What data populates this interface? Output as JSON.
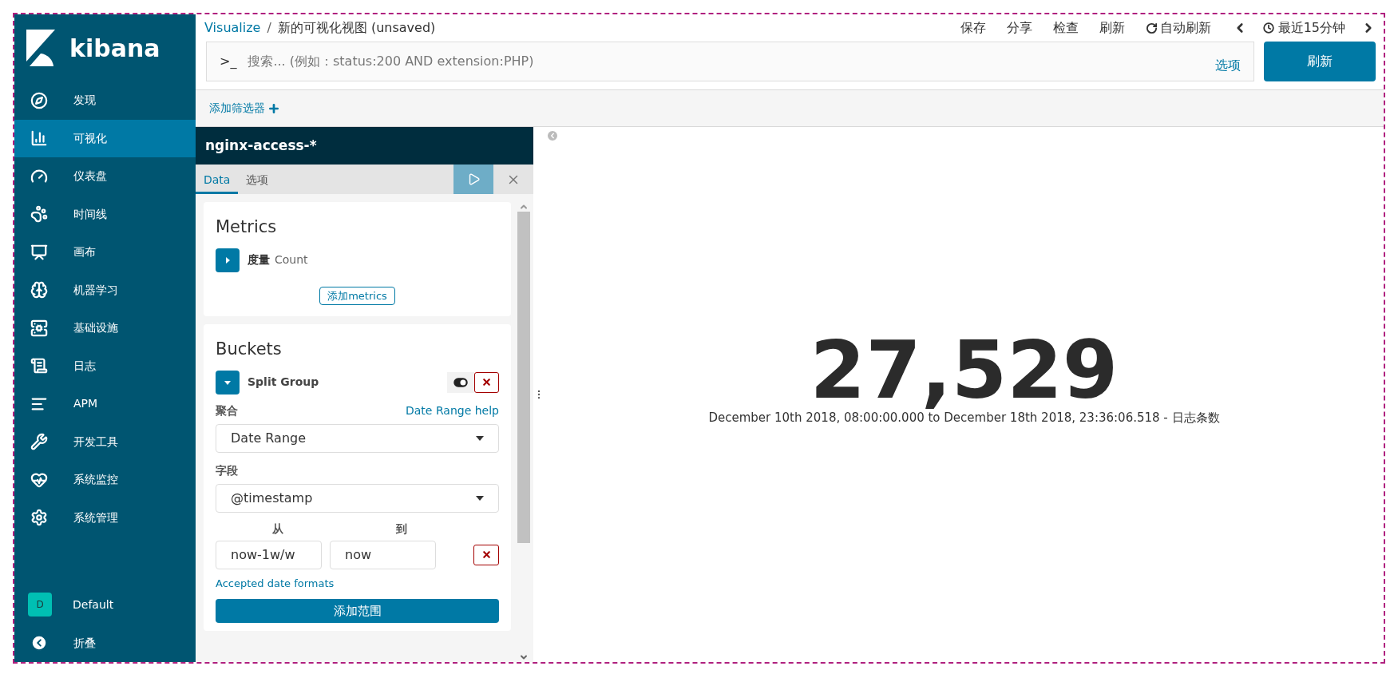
{
  "sidebar": {
    "logo": "kibana",
    "items": [
      {
        "label": "发现",
        "selected": false
      },
      {
        "label": "可视化",
        "selected": true
      },
      {
        "label": "仪表盘",
        "selected": false
      },
      {
        "label": "时间线",
        "selected": false
      },
      {
        "label": "画布",
        "selected": false
      },
      {
        "label": "机器学习",
        "selected": false
      },
      {
        "label": "基础设施",
        "selected": false
      },
      {
        "label": "日志",
        "selected": false
      },
      {
        "label": "APM",
        "selected": false
      },
      {
        "label": "开发工具",
        "selected": false
      },
      {
        "label": "系统监控",
        "selected": false
      },
      {
        "label": "系统管理",
        "selected": false
      }
    ],
    "space": {
      "badge": "D",
      "label": "Default"
    },
    "collapse": "折叠"
  },
  "header": {
    "breadcrumb_link": "Visualize",
    "separator": "/",
    "title": "新的可视化视图 (unsaved)",
    "menu": [
      "保存",
      "分享",
      "检查",
      "刷新"
    ],
    "auto_refresh": "自动刷新",
    "time_range": "最近15分钟"
  },
  "query": {
    "prompt": ">_",
    "placeholder": "搜索... (例如：status:200 AND extension:PHP)",
    "options": "选项",
    "submit": "刷新"
  },
  "filter_bar": {
    "add_filter": "添加筛选器"
  },
  "editor": {
    "index_pattern": "nginx-access-*",
    "tabs": [
      {
        "label": "Data",
        "selected": true
      },
      {
        "label": "选项",
        "selected": false
      }
    ],
    "metrics": {
      "title": "Metrics",
      "items": [
        {
          "label": "度量",
          "value": "Count",
          "expanded": false
        }
      ],
      "add": "添加metrics"
    },
    "buckets": {
      "title": "Buckets",
      "items": [
        {
          "label": "Split Group",
          "expanded": true,
          "enabled": true
        }
      ],
      "aggregation_label": "聚合",
      "help": "Date Range help",
      "aggregation": "Date Range",
      "field_label": "字段",
      "field": "@timestamp",
      "from_label": "从",
      "to_label": "到",
      "ranges": [
        {
          "from": "now-1w/w",
          "to": "now"
        }
      ],
      "formats_link": "Accepted date formats",
      "add_range": "添加范围"
    }
  },
  "metric_vis": {
    "value": "27,529",
    "caption": "December 10th 2018, 08:00:00.000 to December 18th 2018, 23:36:06.518 - 日志条数"
  }
}
